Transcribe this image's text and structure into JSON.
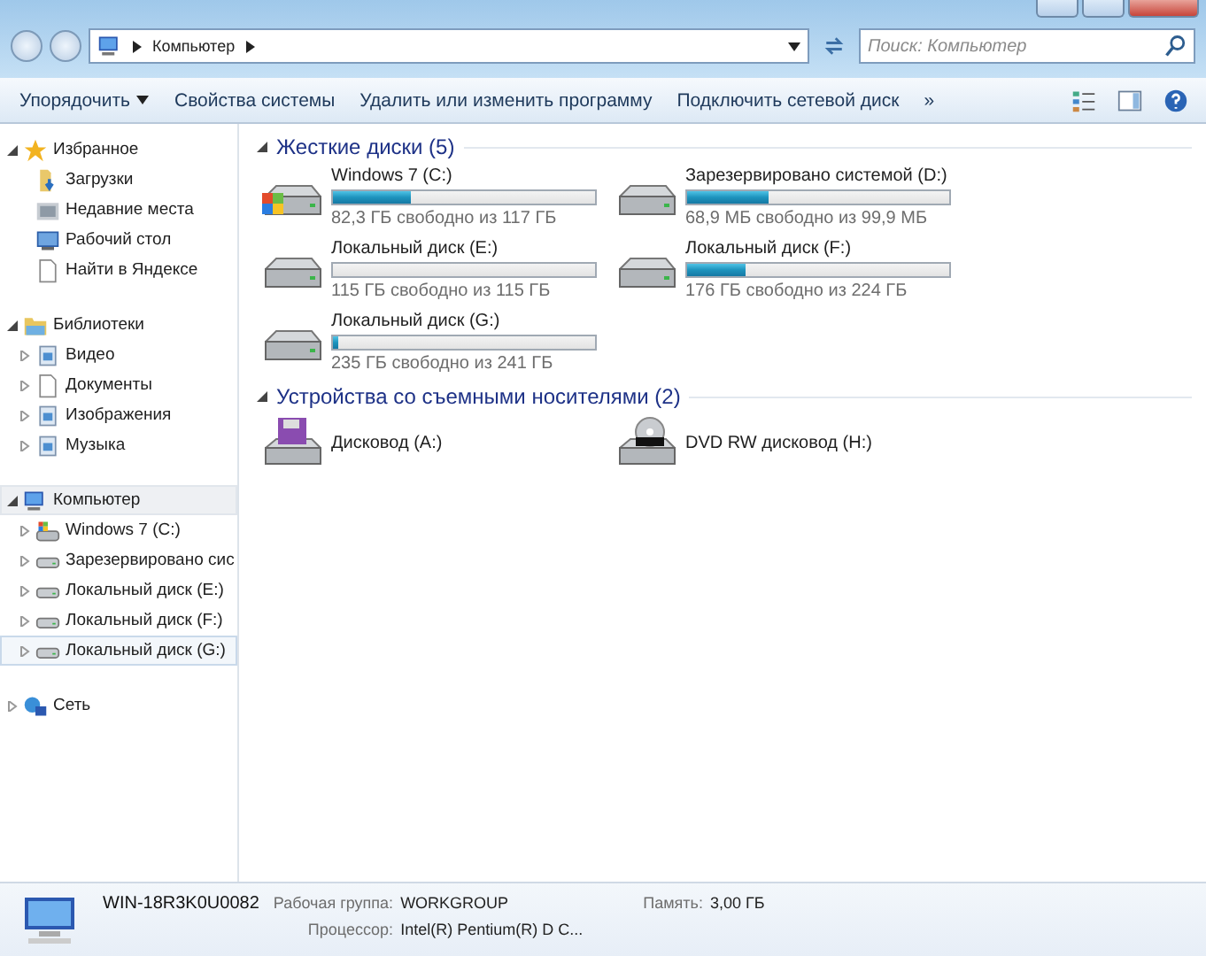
{
  "address": {
    "path": [
      "Компьютер"
    ],
    "search_placeholder": "Поиск: Компьютер"
  },
  "toolbar": {
    "items": [
      {
        "label": "Упорядочить",
        "dropdown": true
      },
      {
        "label": "Свойства системы",
        "dropdown": false
      },
      {
        "label": "Удалить или изменить программу",
        "dropdown": false
      },
      {
        "label": "Подключить сетевой диск",
        "dropdown": false
      }
    ],
    "overflow": "»"
  },
  "sidebar": {
    "groups": [
      {
        "label": "Избранное",
        "kind": "star",
        "expanded": true,
        "selected": false,
        "children": [
          {
            "label": "Загрузки",
            "kind": "download",
            "selected": false
          },
          {
            "label": "Недавние места",
            "kind": "recent",
            "selected": false
          },
          {
            "label": "Рабочий стол",
            "kind": "desktop",
            "selected": false
          },
          {
            "label": "Найти в Яндексе",
            "kind": "page",
            "selected": false
          }
        ]
      },
      {
        "label": "Библиотеки",
        "kind": "library",
        "expanded": true,
        "selected": false,
        "children": [
          {
            "label": "Видео",
            "kind": "lib",
            "selected": false
          },
          {
            "label": "Документы",
            "kind": "page",
            "selected": false
          },
          {
            "label": "Изображения",
            "kind": "lib",
            "selected": false
          },
          {
            "label": "Музыка",
            "kind": "lib",
            "selected": false
          }
        ]
      },
      {
        "label": "Компьютер",
        "kind": "computer",
        "expanded": true,
        "selected": true,
        "children": [
          {
            "label": "Windows 7 (C:)",
            "kind": "windrive",
            "selected": false
          },
          {
            "label": "Зарезервировано сис",
            "kind": "drive",
            "selected": false
          },
          {
            "label": "Локальный диск (E:)",
            "kind": "drive",
            "selected": false
          },
          {
            "label": "Локальный диск (F:)",
            "kind": "drive",
            "selected": false
          },
          {
            "label": "Локальный диск (G:)",
            "kind": "drive",
            "selected": true
          }
        ]
      },
      {
        "label": "Сеть",
        "kind": "network",
        "expanded": false,
        "selected": false
      }
    ]
  },
  "sections": [
    {
      "title": "Жесткие диски (5)",
      "expanded": true,
      "items": [
        {
          "name": "Windows 7 (C:)",
          "kind": "windrive",
          "level": 0.3,
          "free": "82,3 ГБ свободно из 117 ГБ"
        },
        {
          "name": "Зарезервировано системой (D:)",
          "kind": "drive",
          "level": 0.31,
          "free": "68,9 МБ свободно из 99,9 МБ"
        },
        {
          "name": "Локальный диск (E:)",
          "kind": "drive",
          "level": 0.0,
          "free": "115 ГБ свободно из 115 ГБ"
        },
        {
          "name": "Локальный диск (F:)",
          "kind": "drive",
          "level": 0.22,
          "free": "176 ГБ свободно из 224 ГБ"
        },
        {
          "name": "Локальный диск (G:)",
          "kind": "drive",
          "level": 0.02,
          "free": "235 ГБ свободно из 241 ГБ"
        }
      ]
    },
    {
      "title": "Устройства со съемными носителями (2)",
      "expanded": true,
      "items": [
        {
          "name": "Дисковод (A:)",
          "kind": "floppy"
        },
        {
          "name": "DVD RW дисковод (H:)",
          "kind": "dvd"
        }
      ]
    }
  ],
  "details": {
    "computer_name": "WIN-18R3K0U0082",
    "fields": [
      {
        "label": "Рабочая группа:",
        "value": "WORKGROUP"
      },
      {
        "label": "Память:",
        "value": "3,00 ГБ"
      },
      {
        "label": "Процессор:",
        "value": "Intel(R) Pentium(R) D C..."
      }
    ]
  }
}
